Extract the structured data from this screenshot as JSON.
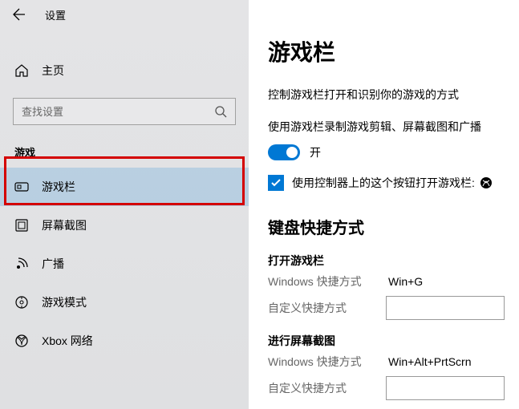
{
  "header": {
    "title": "设置"
  },
  "sidebar": {
    "home_label": "主页",
    "search_placeholder": "查找设置",
    "section_title": "游戏",
    "items": [
      {
        "label": "游戏栏"
      },
      {
        "label": "屏幕截图"
      },
      {
        "label": "广播"
      },
      {
        "label": "游戏模式"
      },
      {
        "label": "Xbox 网络"
      }
    ]
  },
  "content": {
    "title": "游戏栏",
    "desc": "控制游戏栏打开和识别你的游戏的方式",
    "record_label": "使用游戏栏录制游戏剪辑、屏幕截图和广播",
    "toggle_state": "开",
    "checkbox_label": "使用控制器上的这个按钮打开游戏栏:",
    "shortcuts_title": "键盘快捷方式",
    "groups": [
      {
        "title": "打开游戏栏",
        "win_label": "Windows 快捷方式",
        "win_value": "Win+G",
        "custom_label": "自定义快捷方式",
        "custom_value": ""
      },
      {
        "title": "进行屏幕截图",
        "win_label": "Windows 快捷方式",
        "win_value": "Win+Alt+PrtScrn",
        "custom_label": "自定义快捷方式",
        "custom_value": ""
      }
    ]
  }
}
